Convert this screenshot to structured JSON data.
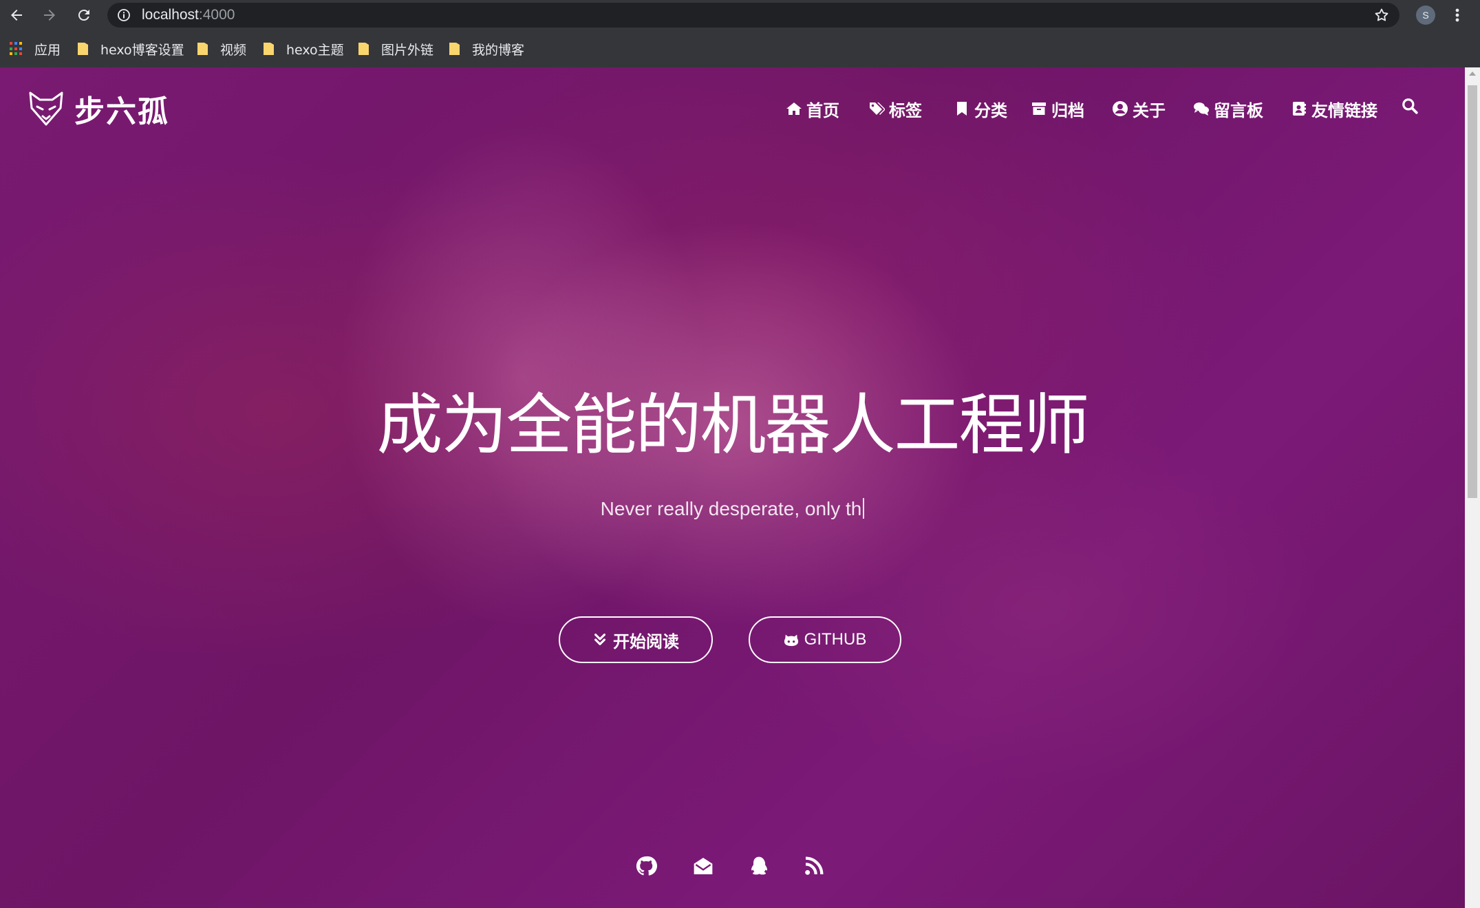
{
  "browser": {
    "url_host": "localhost",
    "url_port": ":4000",
    "profile_initial": "S",
    "bookmarks": [
      {
        "label": "应用",
        "icon": "apps-grid-icon"
      },
      {
        "label": "hexo博客设置",
        "icon": "folder-icon"
      },
      {
        "label": "视频",
        "icon": "folder-icon"
      },
      {
        "label": "hexo主题",
        "icon": "folder-icon"
      },
      {
        "label": "图片外链",
        "icon": "folder-icon"
      },
      {
        "label": "我的博客",
        "icon": "folder-icon"
      }
    ]
  },
  "site": {
    "logo_text": "步六孤",
    "logo_icon": "fox-logo-icon",
    "nav": [
      {
        "label": "首页",
        "icon": "home-icon"
      },
      {
        "label": "标签",
        "icon": "tags-icon"
      },
      {
        "label": "分类",
        "icon": "bookmark-icon"
      },
      {
        "label": "归档",
        "icon": "archive-icon"
      },
      {
        "label": "关于",
        "icon": "user-circle-icon"
      },
      {
        "label": "留言板",
        "icon": "comments-icon"
      },
      {
        "label": "友情链接",
        "icon": "address-book-icon"
      }
    ],
    "search_icon": "search-icon"
  },
  "hero": {
    "title": "成为全能的机器人工程师",
    "subtitle": "Never really desperate, only th",
    "buttons": [
      {
        "label": "开始阅读",
        "icon": "angle-double-down-icon"
      },
      {
        "label": "GITHUB",
        "icon": "github-alt-icon"
      }
    ],
    "social": [
      "github-icon",
      "envelope-open-icon",
      "qq-icon",
      "rss-icon"
    ]
  },
  "colors": {
    "overlay": "#7a1a72",
    "chrome": "#35363a",
    "omnibox": "#202124"
  }
}
